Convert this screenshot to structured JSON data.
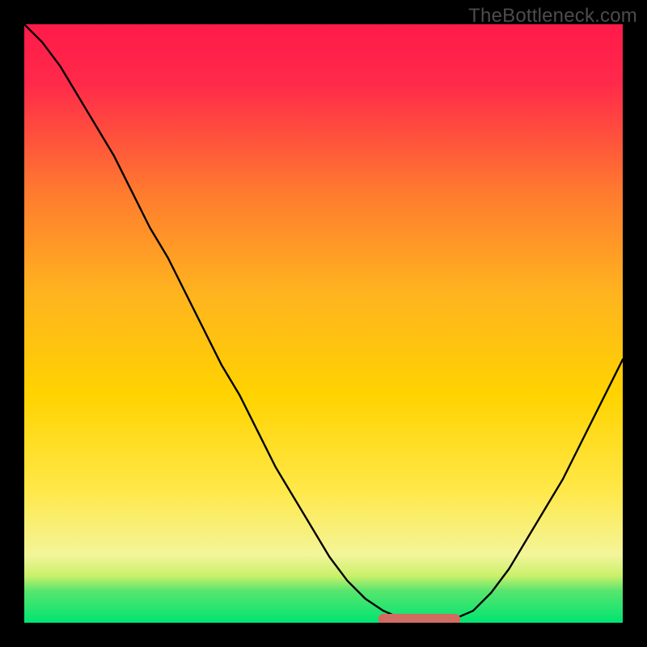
{
  "watermark": "TheBottleneck.com",
  "colors": {
    "gradient_top": "#ff1a4a",
    "gradient_mid": "#ffd500",
    "gradient_bottom": "#00e571",
    "curve": "#000000",
    "highlight_stroke": "#d46a5f",
    "highlight_fill": "#ce6e63"
  },
  "chart_data": {
    "type": "line",
    "title": "",
    "xlabel": "",
    "ylabel": "",
    "x_range": [
      0,
      100
    ],
    "y_range": [
      0,
      100
    ],
    "series": [
      {
        "name": "curve",
        "x": [
          0,
          3,
          6,
          9,
          12,
          15,
          18,
          21,
          24,
          27,
          30,
          33,
          36,
          39,
          42,
          45,
          48,
          51,
          54,
          57,
          60,
          63,
          66,
          69,
          72,
          75,
          78,
          81,
          84,
          87,
          90,
          93,
          96,
          100
        ],
        "y": [
          100,
          97,
          93,
          88,
          83,
          78,
          72,
          66,
          61,
          55,
          49,
          43,
          38,
          32,
          26,
          21,
          16,
          11,
          7,
          4,
          2,
          0.7,
          0.4,
          0.4,
          0.7,
          2,
          5,
          9,
          14,
          19,
          24,
          30,
          36,
          44
        ]
      }
    ],
    "highlight": {
      "x_start": 60,
      "x_end": 72,
      "y": 0.6
    },
    "green_band_top_fraction": 0.083
  }
}
